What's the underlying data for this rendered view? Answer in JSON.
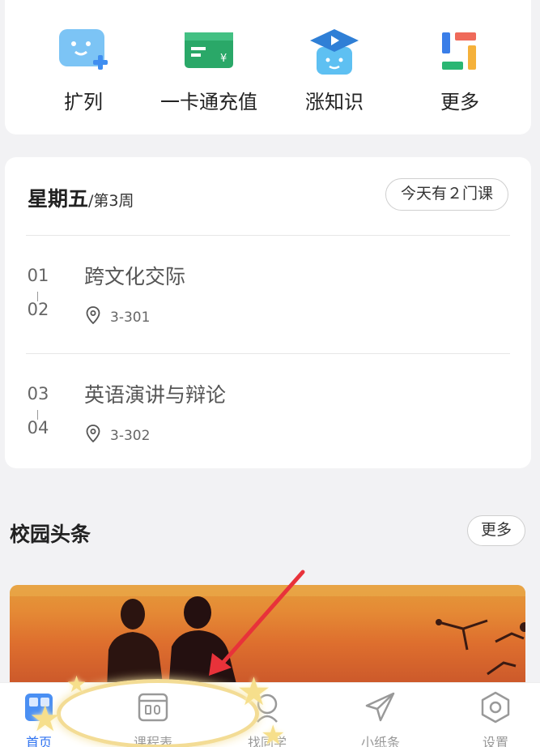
{
  "quick_actions": [
    {
      "label": "扩列",
      "icon": "add-friend-icon"
    },
    {
      "label": "一卡通充值",
      "icon": "card-recharge-icon"
    },
    {
      "label": "涨知识",
      "icon": "graduation-cap-icon"
    },
    {
      "label": "更多",
      "icon": "more-grid-icon"
    }
  ],
  "schedule": {
    "weekday": "星期五",
    "week": "/第3周",
    "today_count": "今天有２门课",
    "courses": [
      {
        "start": "01",
        "end": "02",
        "name": "跨文化交际",
        "location": "3-301"
      },
      {
        "start": "03",
        "end": "04",
        "name": "英语演讲与辩论",
        "location": "3-302"
      }
    ]
  },
  "news": {
    "title": "校园头条",
    "more": "更多"
  },
  "tabbar": {
    "items": [
      {
        "label": "首页",
        "icon": "home-icon",
        "active": true
      },
      {
        "label": "课程表",
        "icon": "schedule-icon",
        "active": false
      },
      {
        "label": "找同学",
        "icon": "find-classmates-icon",
        "active": false
      },
      {
        "label": "小纸条",
        "icon": "paper-plane-icon",
        "active": false
      },
      {
        "label": "设置",
        "icon": "settings-icon",
        "active": false
      }
    ]
  },
  "colors": {
    "accent": "#2f73f0",
    "annotation_arrow": "#e8323a",
    "annotation_highlight": "#f3dc95"
  }
}
